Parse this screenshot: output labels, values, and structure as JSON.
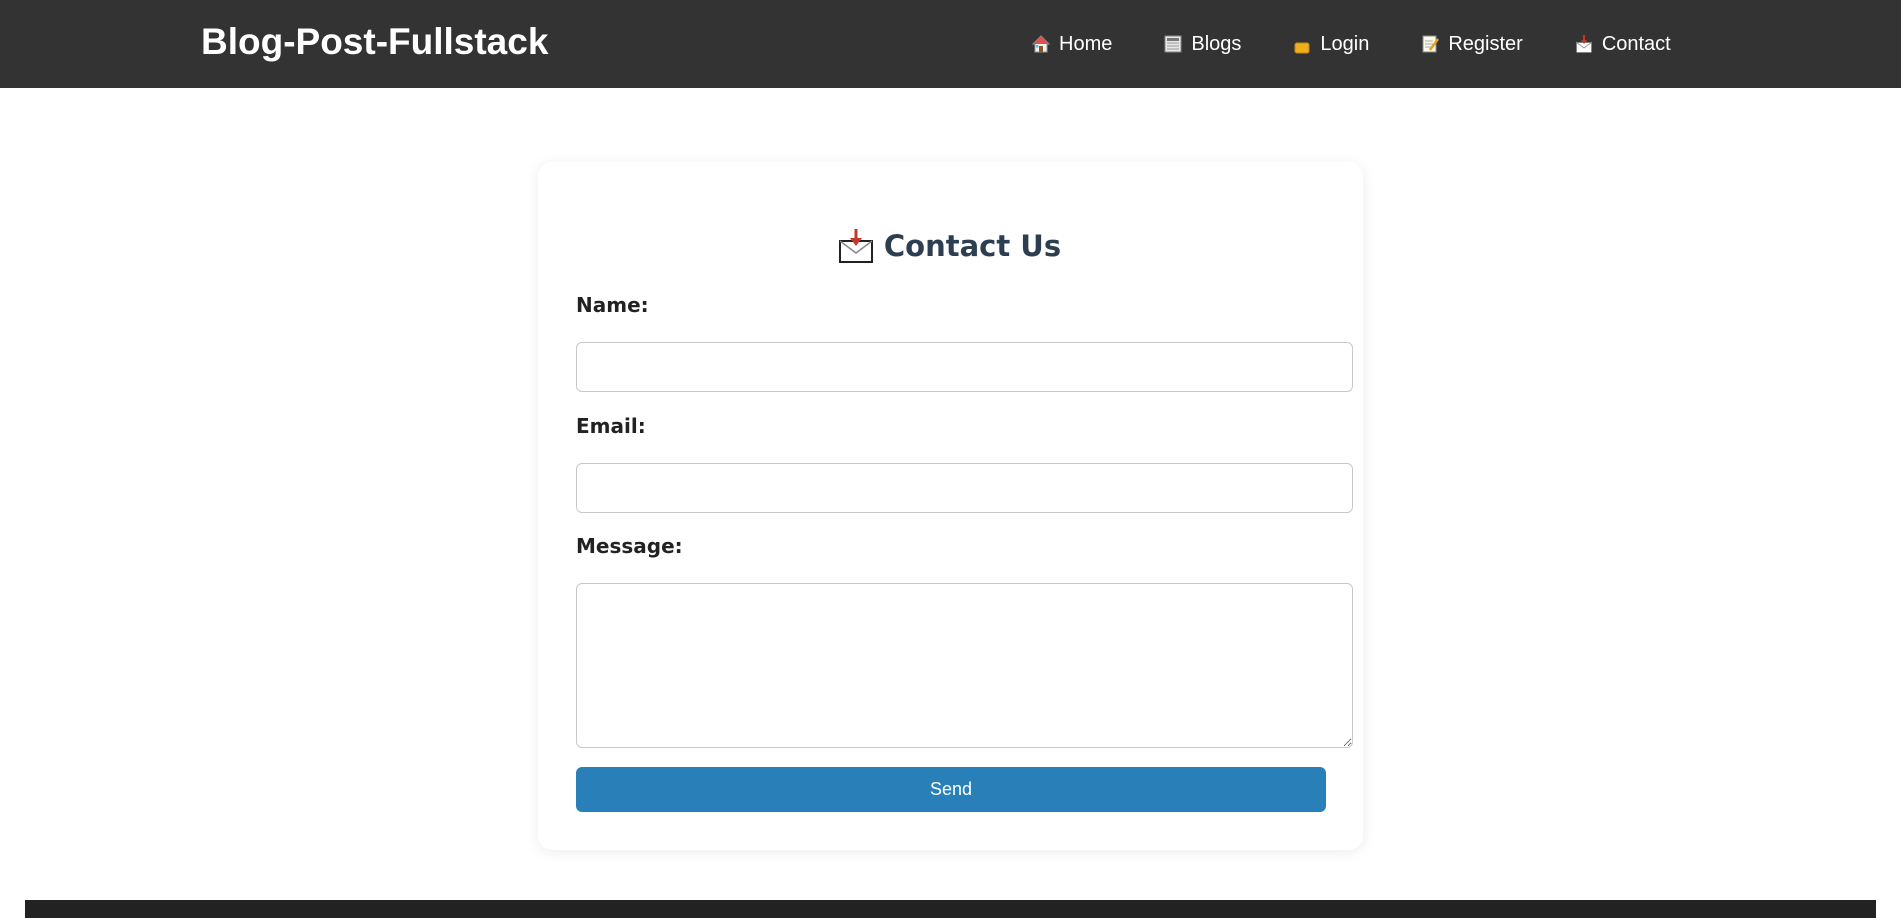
{
  "navbar": {
    "brand": "Blog-Post-Fullstack",
    "background": "#333333",
    "links": [
      {
        "label": "Home",
        "icon": "house-icon"
      },
      {
        "label": "Blogs",
        "icon": "newspaper-icon"
      },
      {
        "label": "Login",
        "icon": "lock-icon"
      },
      {
        "label": "Register",
        "icon": "memo-icon"
      },
      {
        "label": "Contact",
        "icon": "inbox-envelope-icon"
      }
    ]
  },
  "contact_form": {
    "title": "Contact Us",
    "title_icon": "envelope-arrow-icon",
    "title_color": "#2c3e50",
    "name_label": "Name:",
    "name_value": "",
    "email_label": "Email:",
    "email_value": "",
    "message_label": "Message:",
    "message_value": "",
    "submit_label": "Send",
    "submit_color": "#2980b9"
  },
  "footer": {
    "background": "#222222"
  }
}
